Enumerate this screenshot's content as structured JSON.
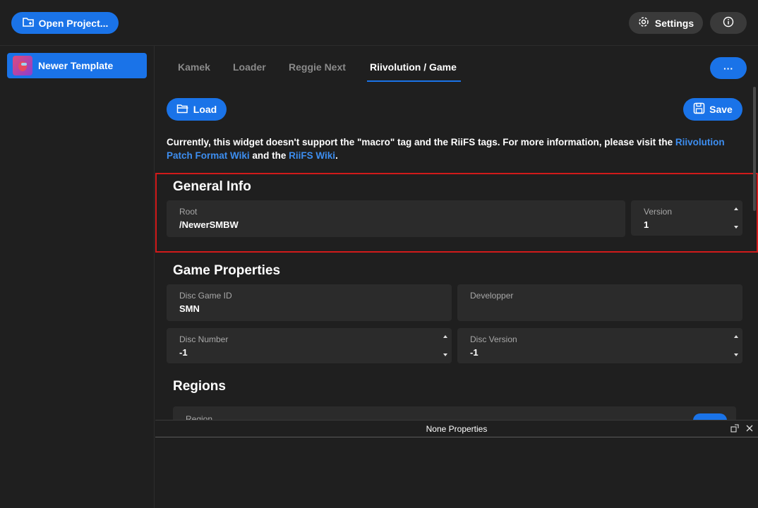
{
  "topbar": {
    "open_project_label": "Open Project...",
    "settings_label": "Settings"
  },
  "sidebar": {
    "items": [
      {
        "label": "Newer Template"
      }
    ]
  },
  "tabs": [
    {
      "label": "Kamek"
    },
    {
      "label": "Loader"
    },
    {
      "label": "Reggie Next"
    },
    {
      "label": "Riivolution / Game",
      "active": true
    }
  ],
  "more_label": "···",
  "actions": {
    "load_label": "Load",
    "save_label": "Save"
  },
  "notice": {
    "text1": "Currently, this widget doesn't support the \"macro\" tag and the RiiFS tags. For more information, please visit the",
    "link1": "Riivolution Patch Format Wiki",
    "text2": " and the ",
    "link2": "RiiFS Wiki",
    "text3": "."
  },
  "general_info": {
    "title": "General Info",
    "root_label": "Root",
    "root_value": "/NewerSMBW",
    "version_label": "Version",
    "version_value": "1"
  },
  "game_properties": {
    "title": "Game Properties",
    "disc_game_id_label": "Disc Game ID",
    "disc_game_id_value": "SMN",
    "developper_label": "Developper",
    "developper_value": "",
    "disc_number_label": "Disc Number",
    "disc_number_value": "-1",
    "disc_version_label": "Disc Version",
    "disc_version_value": "-1"
  },
  "regions": {
    "title": "Regions",
    "partial_label": "Region"
  },
  "bottom_panel": {
    "title": "None Properties"
  },
  "colors": {
    "accent": "#1a73e8",
    "link": "#3d8ef0",
    "highlight_border": "#d11a1a",
    "background": "#1f1f1f",
    "field_bg": "#2b2b2b"
  }
}
